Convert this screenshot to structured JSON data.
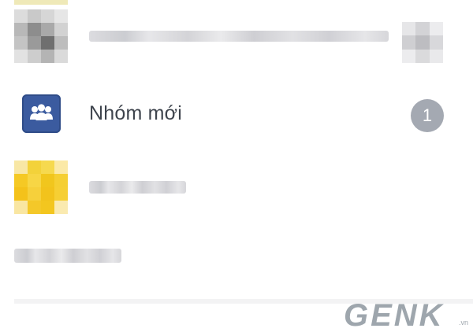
{
  "group_row": {
    "icon": "group-icon",
    "title": "Nhóm mới",
    "badge_count": "1",
    "icon_color": "#3b5b9f"
  },
  "watermark": {
    "logo": "GENK",
    "suffix": ".vn"
  }
}
